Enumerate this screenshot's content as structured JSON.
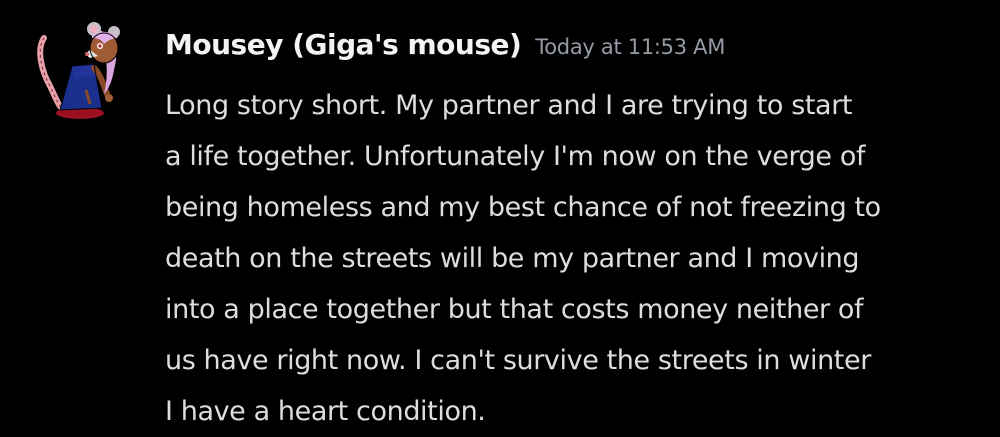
{
  "message": {
    "author": "Mousey (Giga's mouse)",
    "timestamp": "Today at 11:53 AM",
    "avatar": "mouse-character-avatar",
    "lines": [
      "Long story short. My partner and I are trying to start",
      "a life together. Unfortunately I'm now on the verge of",
      "being homeless and my best chance of not freezing to",
      "death on the streets will be my partner and I moving",
      "into a place together but that costs money neither of",
      "us have right now. I can't survive the streets in winter",
      "I have a heart condition."
    ]
  },
  "colors": {
    "background": "#000000",
    "author": "#f2f3f5",
    "timestamp": "#949ba4",
    "text": "#dbdee1"
  }
}
